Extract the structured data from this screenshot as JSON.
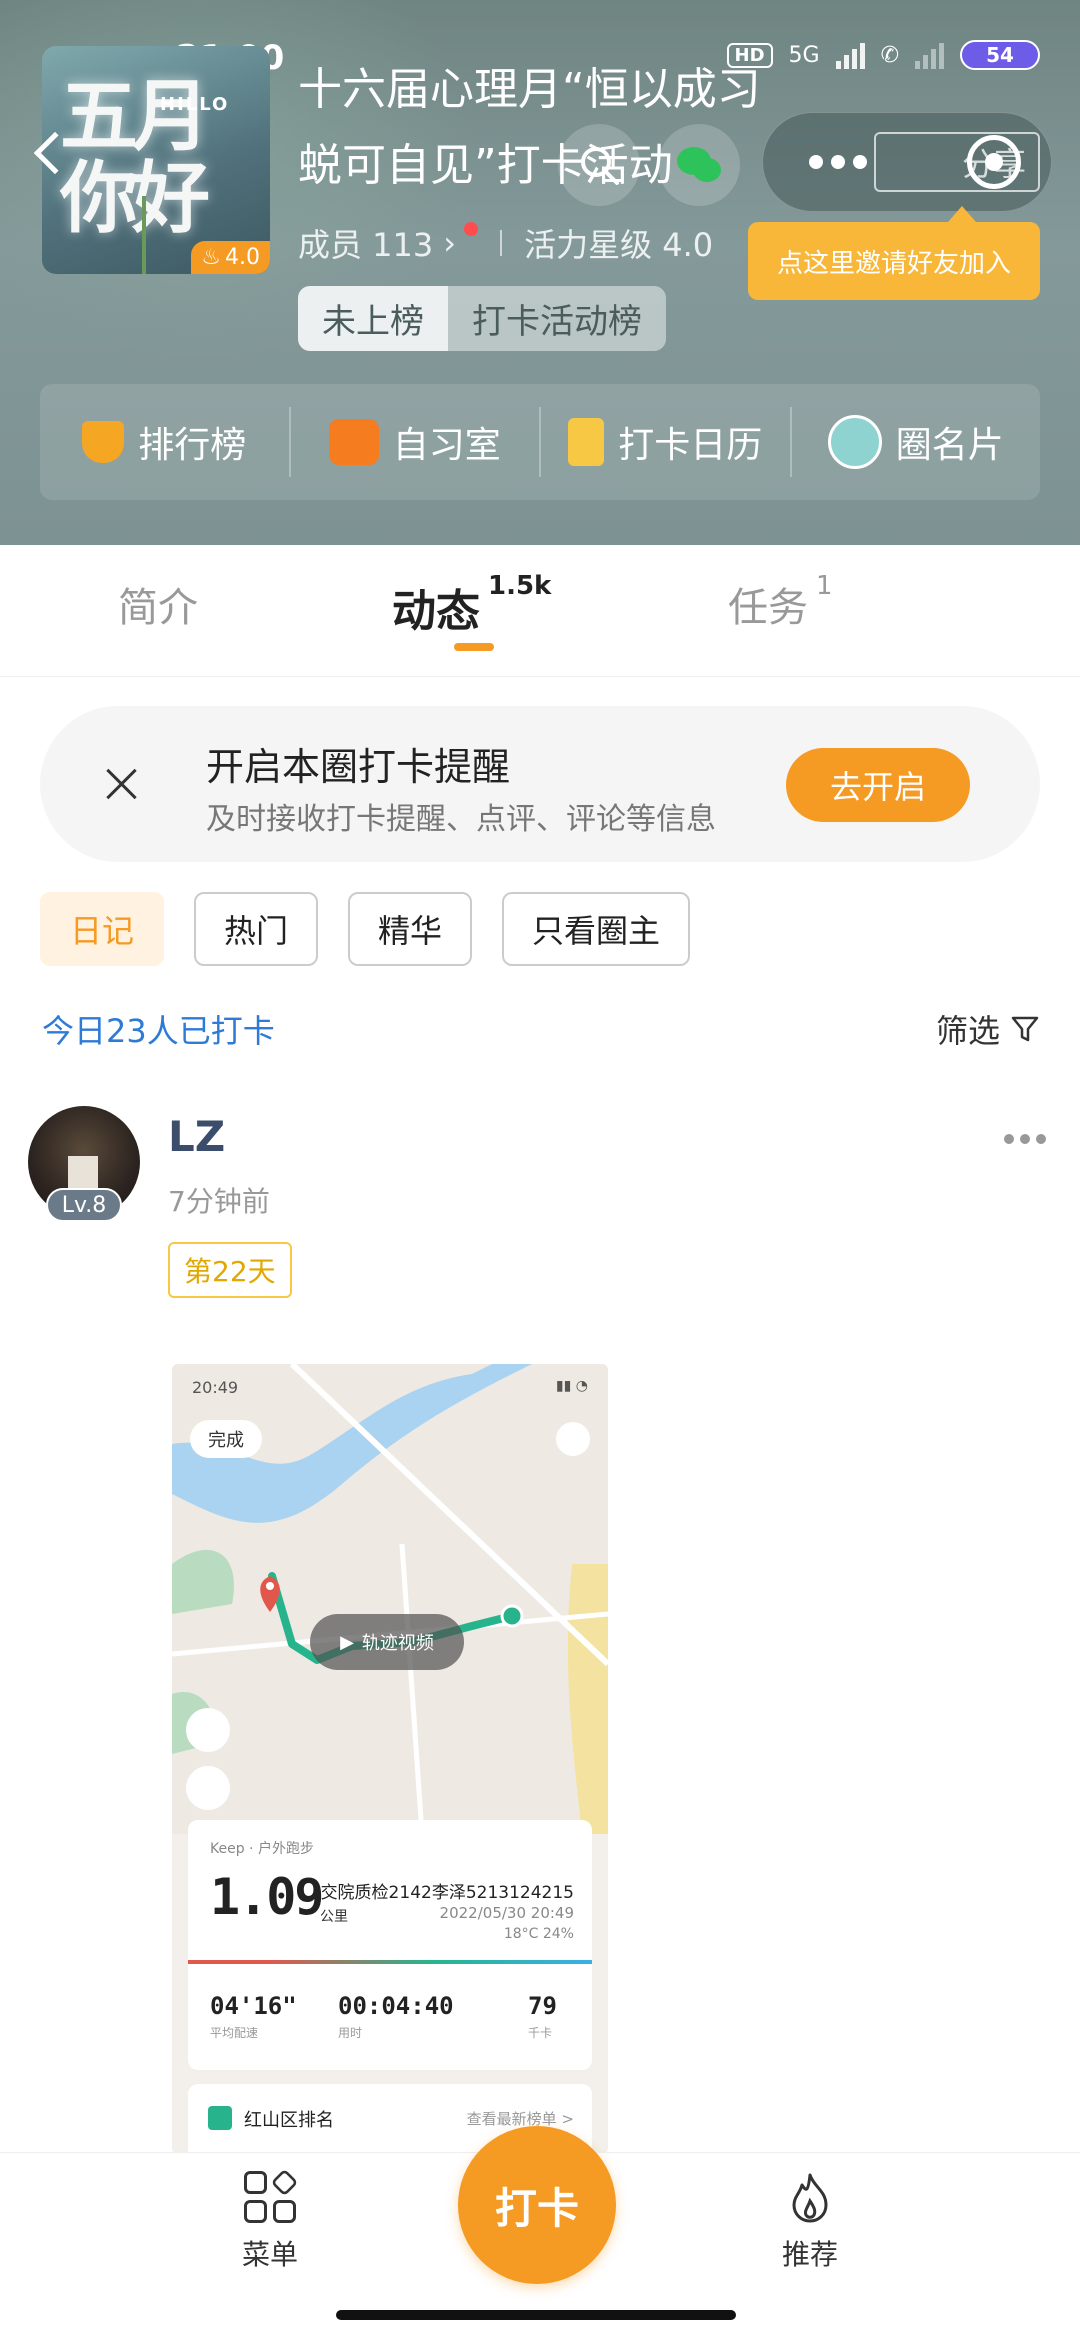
{
  "status_bar": {
    "time": "21:00",
    "network": "5G",
    "hd": "HD",
    "battery": "54"
  },
  "group": {
    "cover_text": "五月你好",
    "cover_hello": "HILLO",
    "rating": "4.0",
    "title": "十六届心理月“恒以成习 蜕可自见”打卡活动",
    "members": "成员 113",
    "vitality": "活力星级 4.0",
    "rank_status": "未上榜",
    "rank_board": "打卡活动榜",
    "share_label": "分享",
    "invite_tip": "点这里邀请好友加入"
  },
  "quick_actions": [
    {
      "label": "排行榜",
      "icon": "trophy-icon"
    },
    {
      "label": "自习室",
      "icon": "study-room-icon"
    },
    {
      "label": "打卡日历",
      "icon": "calendar-icon"
    },
    {
      "label": "圈名片",
      "icon": "circle-card-icon"
    }
  ],
  "tabs": [
    {
      "label": "简介",
      "count": ""
    },
    {
      "label": "动态",
      "count": "1.5k"
    },
    {
      "label": "任务",
      "count": "1"
    }
  ],
  "reminder": {
    "title": "开启本圈打卡提醒",
    "subtitle": "及时接收打卡提醒、点评、评论等信息",
    "button": "去开启"
  },
  "filters": [
    "日记",
    "热门",
    "精华",
    "只看圈主"
  ],
  "today_count": "今日23人已打卡",
  "filter_label": "筛选",
  "post": {
    "username": "LZ",
    "level": "Lv.8",
    "time": "7分钟前",
    "day": "第22天",
    "image": {
      "status_time": "20:49",
      "done_label": "完成",
      "track_video": "轨迹视频",
      "app": "Keep · 户外跑步",
      "distance": "1.09",
      "distance_unit": "公里",
      "runner": "交院质检2142李泽5213124215",
      "date": "2022/05/30 20:49",
      "weather": "18°C  24%",
      "pace": "04'16\"",
      "pace_label": "平均配速",
      "duration": "00:04:40",
      "duration_label": "用时",
      "calories": "79",
      "calories_label": "千卡",
      "rank_title": "红山区排名",
      "rank_more": "查看最新榜单 >"
    }
  },
  "bottom_nav": {
    "menu": "菜单",
    "checkin": "打卡",
    "recommend": "推荐"
  },
  "colors": {
    "accent": "#f59a23",
    "link": "#2d7bd6",
    "track": "#27b48d"
  }
}
